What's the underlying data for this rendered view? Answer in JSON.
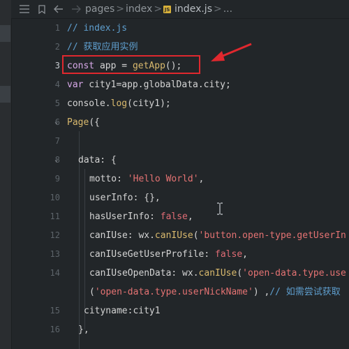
{
  "breadcrumb": {
    "items": [
      "pages",
      "index",
      "index.js",
      "..."
    ],
    "separator": ">",
    "js_badge": "JS"
  },
  "editor": {
    "active_line": 3,
    "lines": [
      {
        "num": "1",
        "tokens": [
          {
            "t": "// index.js",
            "c": "cmt"
          }
        ]
      },
      {
        "num": "2",
        "tokens": [
          {
            "t": "// 获取应用实例",
            "c": "cmt"
          }
        ]
      },
      {
        "num": "3",
        "tokens": [
          {
            "t": "const",
            "c": "kw"
          },
          {
            "t": " app = ",
            "c": "punc"
          },
          {
            "t": "getApp",
            "c": "fn"
          },
          {
            "t": "();",
            "c": "punc"
          }
        ]
      },
      {
        "num": "4",
        "tokens": [
          {
            "t": "var",
            "c": "kw"
          },
          {
            "t": " city1=app.globalData.city;",
            "c": "punc"
          }
        ]
      },
      {
        "num": "5",
        "tokens": [
          {
            "t": "console.",
            "c": "punc"
          },
          {
            "t": "log",
            "c": "fn"
          },
          {
            "t": "(city1);",
            "c": "punc"
          }
        ]
      },
      {
        "num": "6",
        "tokens": [
          {
            "t": "Page",
            "c": "fn"
          },
          {
            "t": "({",
            "c": "punc"
          }
        ]
      },
      {
        "num": "7",
        "tokens": []
      },
      {
        "num": "8",
        "tokens": [
          {
            "t": "data: {",
            "c": "punc"
          }
        ]
      },
      {
        "num": "9",
        "tokens": [
          {
            "t": "motto: ",
            "c": "punc"
          },
          {
            "t": "'Hello World'",
            "c": "str"
          },
          {
            "t": ",",
            "c": "punc"
          }
        ]
      },
      {
        "num": "10",
        "tokens": [
          {
            "t": "userInfo: {},",
            "c": "punc"
          }
        ]
      },
      {
        "num": "11",
        "tokens": [
          {
            "t": "hasUserInfo: ",
            "c": "punc"
          },
          {
            "t": "false",
            "c": "bool"
          },
          {
            "t": ",",
            "c": "punc"
          }
        ]
      },
      {
        "num": "12",
        "tokens": [
          {
            "t": "canIUse: wx.",
            "c": "punc"
          },
          {
            "t": "canIUse",
            "c": "fn"
          },
          {
            "t": "(",
            "c": "punc"
          },
          {
            "t": "'button.open-type.getUserIn",
            "c": "str"
          }
        ]
      },
      {
        "num": "13",
        "tokens": [
          {
            "t": "canIUseGetUserProfile: ",
            "c": "punc"
          },
          {
            "t": "false",
            "c": "bool"
          },
          {
            "t": ",",
            "c": "punc"
          }
        ]
      },
      {
        "num": "14",
        "tokens": [
          {
            "t": "canIUseOpenData: wx.",
            "c": "punc"
          },
          {
            "t": "canIUse",
            "c": "fn"
          },
          {
            "t": "(",
            "c": "punc"
          },
          {
            "t": "'open-data.type.use",
            "c": "str"
          }
        ]
      },
      {
        "num": "",
        "tokens": [
          {
            "t": "(",
            "c": "punc"
          },
          {
            "t": "'open-data.type.userNickName'",
            "c": "str"
          },
          {
            "t": ") ,",
            "c": "punc"
          },
          {
            "t": "// 如需尝试获取",
            "c": "cmt"
          }
        ]
      },
      {
        "num": "15",
        "tokens": [
          {
            "t": "cityname:city1",
            "c": "punc"
          }
        ]
      },
      {
        "num": "16",
        "tokens": [
          {
            "t": "},",
            "c": "punc"
          }
        ]
      }
    ]
  },
  "annotation": {
    "box_color": "#e0282e",
    "arrow_color": "#e0282e"
  },
  "colors": {
    "background": "#222629",
    "comment": "#5f9fcf",
    "keyword": "#d7a8e8",
    "function": "#d9b96d",
    "string": "#e57373"
  }
}
